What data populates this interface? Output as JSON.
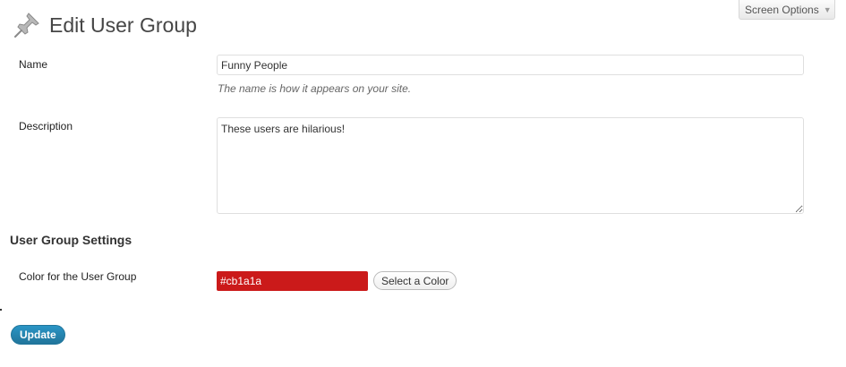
{
  "header": {
    "title": "Edit User Group",
    "screen_options_label": "Screen Options",
    "screen_options_arrow": "▼"
  },
  "form": {
    "name": {
      "label": "Name",
      "value": "Funny People",
      "help": "The name is how it appears on your site."
    },
    "description": {
      "label": "Description",
      "value": "These users are hilarious!"
    }
  },
  "settings": {
    "section_title": "User Group Settings",
    "color_label": "Color for the User Group",
    "color_value": "#cb1a1a",
    "select_color_label": "Select a Color"
  },
  "actions": {
    "update_label": "Update"
  },
  "colors": {
    "swatch": "#cb1a1a",
    "primary_button": "#21759b"
  },
  "icons": {
    "title_icon": "pushpin-icon",
    "screen_options_icon": "triangle-down-icon"
  }
}
